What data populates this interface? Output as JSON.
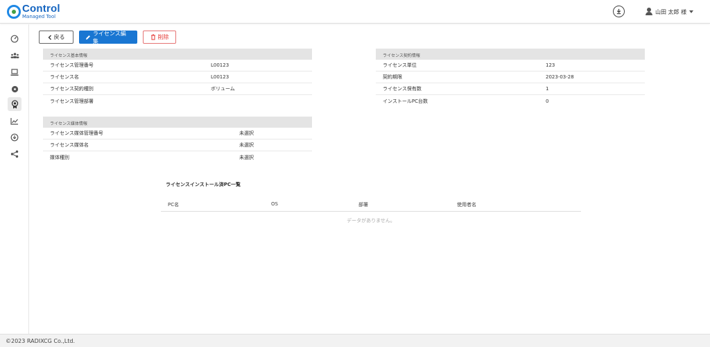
{
  "header": {
    "logo_main": "Control",
    "logo_sub": "Managed Tool",
    "user_name": "山田 太郎 様"
  },
  "sidebar": {
    "items": [
      {
        "icon": "speedometer-icon"
      },
      {
        "icon": "group-icon"
      },
      {
        "icon": "laptop-icon"
      },
      {
        "icon": "disc-icon"
      },
      {
        "icon": "license-badge-icon",
        "active": true
      },
      {
        "icon": "chart-icon"
      },
      {
        "icon": "download-circle-icon"
      },
      {
        "icon": "share-icon"
      }
    ]
  },
  "toolbar": {
    "back_label": "戻る",
    "edit_label": "ライセンス編集",
    "delete_label": "削除"
  },
  "basic_info": {
    "title": "ライセンス基本情報",
    "rows": [
      {
        "label": "ライセンス管理番号",
        "value": "L00123"
      },
      {
        "label": "ライセンス名",
        "value": "L00123"
      },
      {
        "label": "ライセンス契約種別",
        "value": "ボリューム"
      },
      {
        "label": "ライセンス管理部署",
        "value": ""
      }
    ]
  },
  "contract_info": {
    "title": "ライセンス契約情報",
    "rows": [
      {
        "label": "ライセンス単位",
        "value": "123"
      },
      {
        "label": "契約期限",
        "value": "2023-03-28"
      },
      {
        "label": "ライセンス保有数",
        "value": "1"
      },
      {
        "label": "インストールPC台数",
        "value": "0"
      }
    ]
  },
  "media_info": {
    "title": "ライセンス媒体情報",
    "rows": [
      {
        "label": "ライセンス媒体管理番号",
        "value": "未選択"
      },
      {
        "label": "ライセンス媒体名",
        "value": "未選択"
      },
      {
        "label": "媒体種別",
        "value": "未選択"
      }
    ]
  },
  "pc_list": {
    "title": "ライセンスインストール済PC一覧",
    "columns": [
      "PC名",
      "OS",
      "部署",
      "使用者名"
    ],
    "empty_text": "データがありません。"
  },
  "footer": {
    "copyright": "©2023 RADIXCG Co.,Ltd."
  }
}
